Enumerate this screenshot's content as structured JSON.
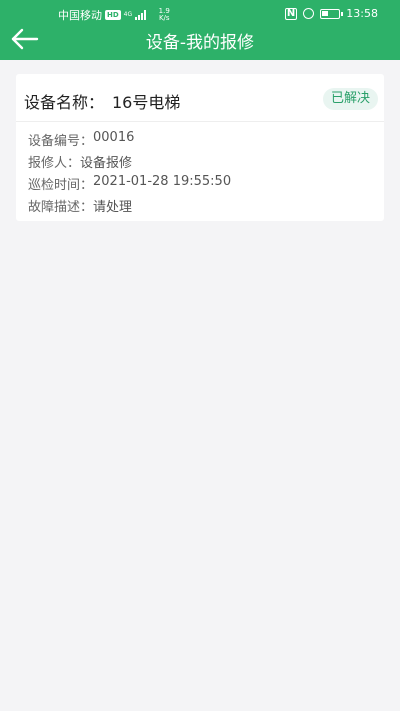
{
  "statusbar": {
    "carrier": "中国移动",
    "hd": "HD",
    "network": "4G",
    "speed_value": "1.9",
    "speed_unit": "K/s",
    "nfc": "N",
    "time": "13:58"
  },
  "header": {
    "title": "设备-我的报修"
  },
  "card": {
    "name_label": "设备名称：",
    "name_value": "16号电梯",
    "status": "已解决",
    "fields": [
      {
        "label": "设备编号：",
        "value": "00016"
      },
      {
        "label": "报修人：",
        "value": "设备报修"
      },
      {
        "label": "巡检时间：",
        "value": "2021-01-28 19:55:50"
      },
      {
        "label": "故障描述：",
        "value": "请处理"
      }
    ]
  },
  "colors": {
    "appbar": "#2db169",
    "badge_bg": "#e9f5f1",
    "badge_text": "#2aa06a",
    "background": "#f4f4f6"
  },
  "icons": {
    "back": "back-arrow-icon",
    "signal": "signal-icon",
    "nfc": "nfc-icon",
    "alarm": "alarm-icon",
    "battery": "battery-icon"
  }
}
